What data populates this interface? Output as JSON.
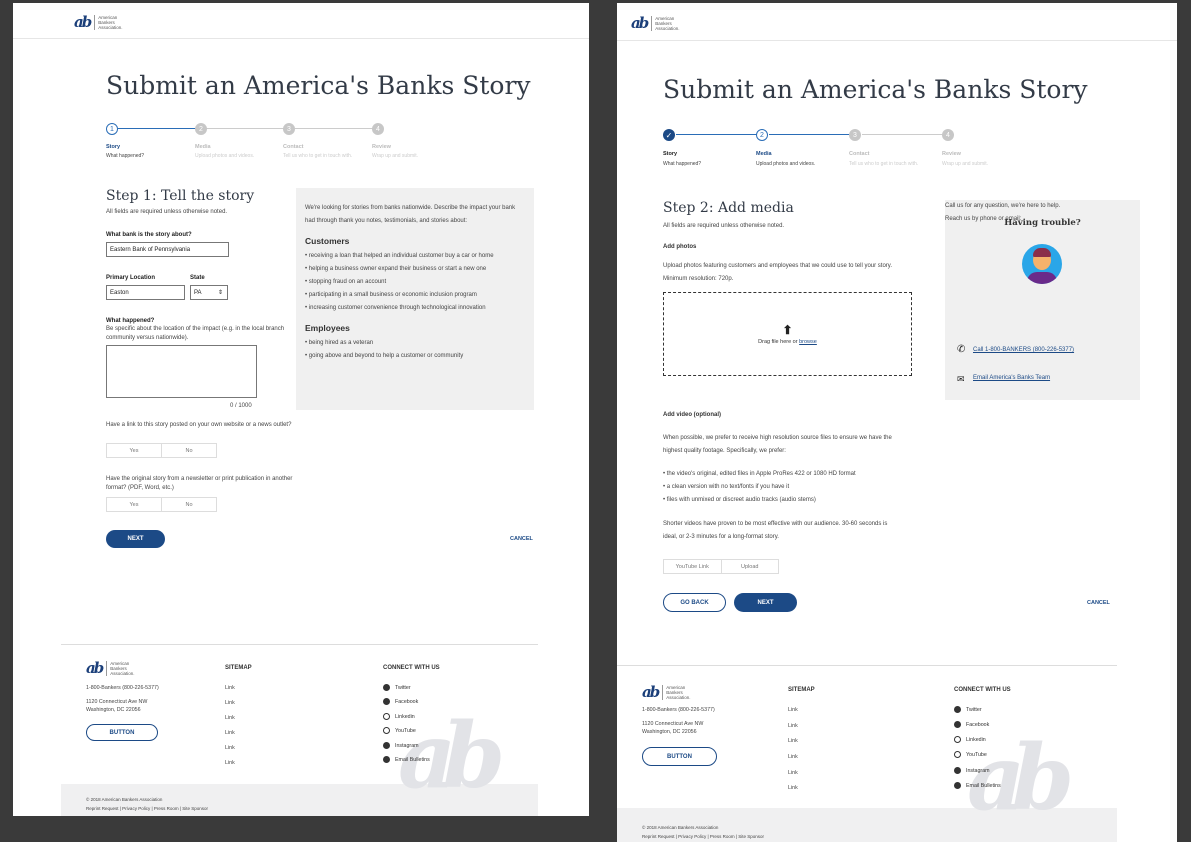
{
  "logo_text": "American\nBankers\nAssociation.",
  "page1": {
    "title": "Submit an America's Banks Story",
    "steps": [
      {
        "label": "Story",
        "desc": "What happened?",
        "n": "1"
      },
      {
        "label": "Media",
        "desc": "Upload photos and videos.",
        "n": "2"
      },
      {
        "label": "Contact",
        "desc": "Tell us who to get in touch with.",
        "n": "3"
      },
      {
        "label": "Review",
        "desc": "Wrap up and submit.",
        "n": "4"
      }
    ],
    "heading": "Step 1: Tell the story",
    "required_note": "All fields are required unless otherwise noted.",
    "bank_label": "What bank is the story about?",
    "bank_value": "Eastern Bank of Pennsylvania",
    "location_label": "Primary Location",
    "location_value": "Easton",
    "state_label": "State",
    "state_value": "PA",
    "happened_label": "What happened?",
    "happened_help": "Be specific about the location of the impact (e.g. in the local branch community versus nationwide).",
    "counter": "0 / 1000",
    "q_link": "Have a link to this story posted on your own website or a news outlet?",
    "q_original": "Have the original story from a newsletter or print publication in another format? (PDF, Word, etc.)",
    "yes": "Yes",
    "no": "No",
    "next": "NEXT",
    "cancel": "CANCEL",
    "side_intro": "We're looking for stories from banks nationwide. Describe the impact your bank had through thank you notes, testimonials, and stories about:",
    "side_customers": "Customers",
    "customers": [
      "• receiving a loan that helped an individual customer buy a car or home",
      "• helping a business owner expand their business or start a new one",
      "• stopping fraud on an account",
      "• participating in a small business or economic inclusion program",
      "• increasing customer convenience through technological innovation"
    ],
    "side_employees": "Employees",
    "employees": [
      "• being hired as a veteran",
      "• going above and beyond to help a customer or community"
    ]
  },
  "page2": {
    "title": "Submit an America's Banks Story",
    "steps": [
      {
        "label": "Story",
        "desc": "What happened?",
        "n": "✓"
      },
      {
        "label": "Media",
        "desc": "Upload photos and videos.",
        "n": "2"
      },
      {
        "label": "Contact",
        "desc": "Tell us who to get in touch with.",
        "n": "3"
      },
      {
        "label": "Review",
        "desc": "Wrap up and submit.",
        "n": "4"
      }
    ],
    "heading": "Step 2: Add media",
    "required_note": "All fields are required unless otherwise noted.",
    "photos_label": "Add photos",
    "photos_desc": "Upload photos featuring customers and employees that we could use to tell your story. Minimum resolution: 720p.",
    "drag": "Drag file here or ",
    "browse": "browse",
    "video_label": "Add video (optional)",
    "video_desc": "When possible, we prefer to receive high resolution source files to ensure we have the highest  quality footage. Specifically, we prefer:",
    "video_bullets": [
      "• the video's original, edited files in Apple ProRes 422 or 1080 HD format",
      "• a clean version with no text/fonts if you have it",
      "• files with unmixed or discreet audio tracks (audio stems)"
    ],
    "video_note": "Shorter videos have proven to be most effective with our audience. 30-60 seconds is ideal, or 2-3 minutes for a long-format story.",
    "yt": "YouTube Link",
    "upload": "Upload",
    "back": "GO BACK",
    "next": "NEXT",
    "cancel": "CANCEL",
    "trouble_title": "Having trouble?",
    "trouble_text": "Call us for any question, we're here to help.",
    "reach": "Reach us by phone or email:",
    "call": "Call 1-800-BANKERS (800-226-5377)",
    "email": "Email America's Banks Team"
  },
  "footer": {
    "phone": "1-800-Bankers (800-226-5377)",
    "addr1": "1120 Connecticut Ave NW",
    "addr2": "Washington, DC 22056",
    "button": "BUTTON",
    "sitemap": "SITEMAP",
    "links": [
      "Link",
      "Link",
      "Link",
      "Link",
      "Link",
      "Link"
    ],
    "connect": "CONNECT WITH US",
    "social": [
      "Twitter",
      "Facebook",
      "Linkedin",
      "YouTube",
      "Instagram",
      "Email Bulletins"
    ],
    "copyright": "© 2018 American Bankers Association",
    "legal": "Reprint Request  |  Privacy Policy  |  Press Room  |  Site Sponsor"
  }
}
